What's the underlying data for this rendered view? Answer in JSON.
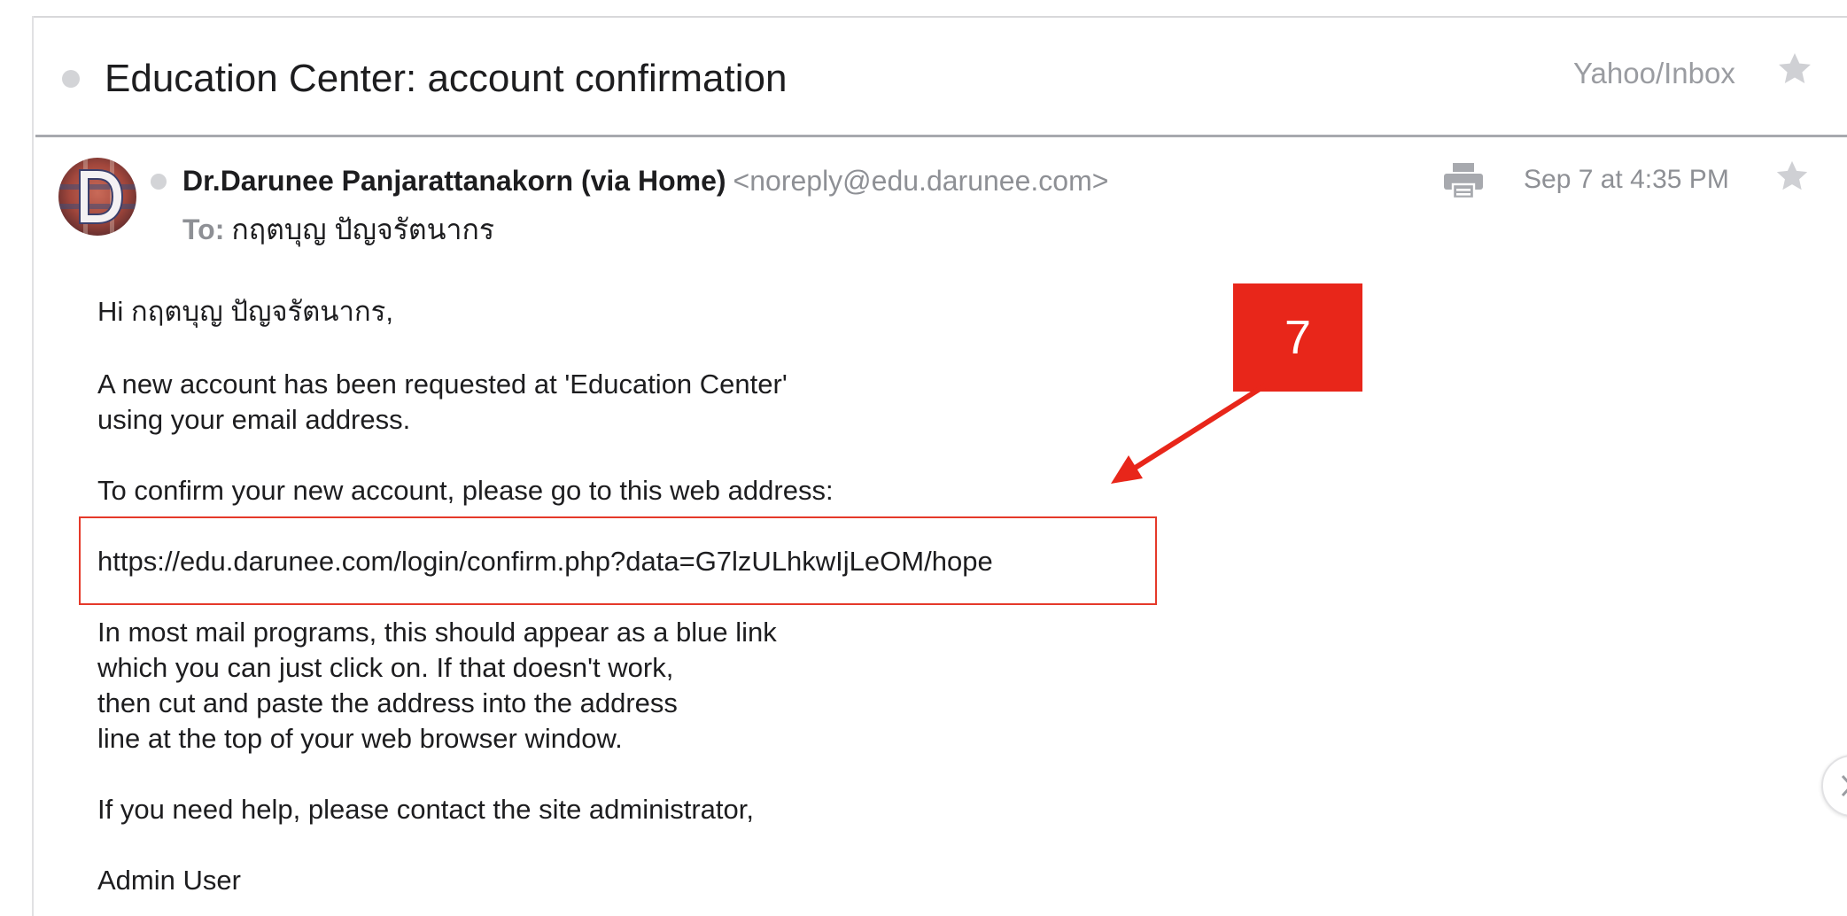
{
  "subject": {
    "title": "Education Center: account confirmation",
    "folder": "Yahoo/Inbox"
  },
  "sender": {
    "name": "Dr.Darunee Panjarattanakorn (via Home)",
    "email": "<noreply@edu.darunee.com>",
    "to_label": "To:",
    "to_name": "กฤตบุญ ปัญจรัตนากร",
    "timestamp": "Sep 7 at 4:35 PM",
    "avatar_letter": "D"
  },
  "body": {
    "greeting": "Hi กฤตบุญ ปัญจรัตนากร,",
    "para1_line1": "A new account has been requested at 'Education Center'",
    "para1_line2": "using your email address.",
    "para2": "To confirm your new account, please go to this web address:",
    "link": "https://edu.darunee.com/login/confirm.php?data=G7lzULhkwIjLeOM/hope",
    "para3_line1": "In most mail programs, this should appear as a blue link",
    "para3_line2": "which you can just click on. If that doesn't work,",
    "para3_line3": "then cut and paste the address into the address",
    "para3_line4": "line at the top of your web browser window.",
    "para4": "If you need help, please contact the site administrator,",
    "signature": "Admin User"
  },
  "annotation": {
    "step_number": "7",
    "color": "#e8261a"
  },
  "icons": {
    "star": "star-icon",
    "print": "print-icon",
    "unread_dot": "unread-dot-icon",
    "scroll_next": "chevron-right-icon"
  }
}
